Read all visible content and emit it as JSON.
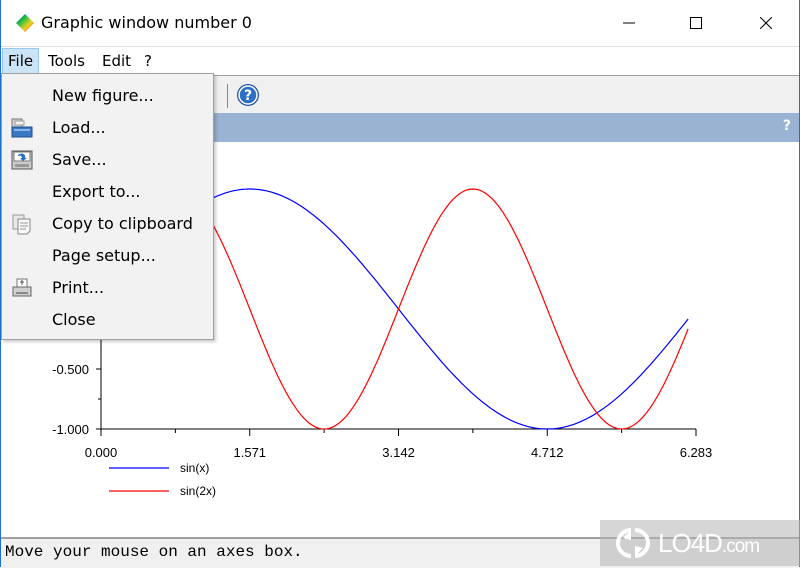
{
  "window": {
    "title": "Graphic window number 0",
    "controls": {
      "minimize": "minimize",
      "maximize": "maximize",
      "close": "close"
    }
  },
  "menubar": {
    "items": [
      {
        "label": "File",
        "active": true
      },
      {
        "label": "Tools",
        "active": false
      },
      {
        "label": "Edit",
        "active": false
      },
      {
        "label": "?",
        "active": false
      }
    ]
  },
  "file_menu": {
    "items": [
      {
        "label": "New figure...",
        "icon": ""
      },
      {
        "label": "Load...",
        "icon": "folder-open-icon"
      },
      {
        "label": "Save...",
        "icon": "save-icon"
      },
      {
        "label": "Export to...",
        "icon": ""
      },
      {
        "label": "Copy to clipboard",
        "icon": "copy-icon"
      },
      {
        "label": "Page setup...",
        "icon": ""
      },
      {
        "label": "Print...",
        "icon": "printer-icon"
      },
      {
        "label": "Close",
        "icon": ""
      }
    ]
  },
  "toolbar": {
    "help_icon": "help-icon"
  },
  "axes_header": {
    "help_label": "?"
  },
  "status": {
    "text": "Move your mouse on an axes box."
  },
  "watermark": {
    "text": "LO4D",
    "suffix": ".com"
  },
  "colors": {
    "sin_x": "#0000ff",
    "sin_2x": "#ff0000",
    "axes_header_bg": "#9ab3d3"
  },
  "chart_data": {
    "type": "line",
    "title": "",
    "xlabel": "",
    "ylabel": "",
    "xlim": [
      0,
      6.283
    ],
    "ylim": [
      -1,
      1
    ],
    "x_ticks": [
      "0.000",
      "1.571",
      "3.142",
      "4.712",
      "6.283"
    ],
    "x_tick_values": [
      0,
      1.571,
      3.142,
      4.712,
      6.283
    ],
    "y_ticks": [
      "-0.500",
      "-1.000"
    ],
    "y_tick_values": [
      -0.5,
      -1.0
    ],
    "grid": false,
    "legend_position": "bottom-left",
    "series": [
      {
        "name": "sin(x)",
        "function": "sin(x)",
        "x_range": [
          0,
          6.2
        ],
        "color": "#0000ff"
      },
      {
        "name": "sin(2x)",
        "function": "sin(2x)",
        "x_range": [
          0,
          6.2
        ],
        "color": "#ff0000"
      }
    ]
  }
}
